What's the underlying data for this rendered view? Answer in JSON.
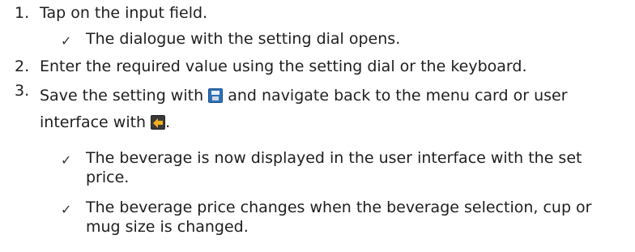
{
  "steps": [
    {
      "num": "1.",
      "text": "Tap on the input field."
    },
    {
      "num": "2.",
      "text": "Enter the required value using the setting dial or the keyboard."
    },
    {
      "num": "3.",
      "text_a": "Save the setting with",
      "text_b": "and navigate back to the menu card or user",
      "text_c": "interface with",
      "text_d": "."
    }
  ],
  "results": [
    {
      "text": "The dialogue with the setting dial opens."
    },
    {
      "line1": "The beverage is now displayed in the user interface with the set",
      "line2": "price."
    },
    {
      "line1": "The beverage price changes when the beverage selection, cup or",
      "line2": "mug size is changed."
    }
  ],
  "icons": {
    "save": "save-icon",
    "back": "back-icon"
  },
  "check_mark": "✓"
}
